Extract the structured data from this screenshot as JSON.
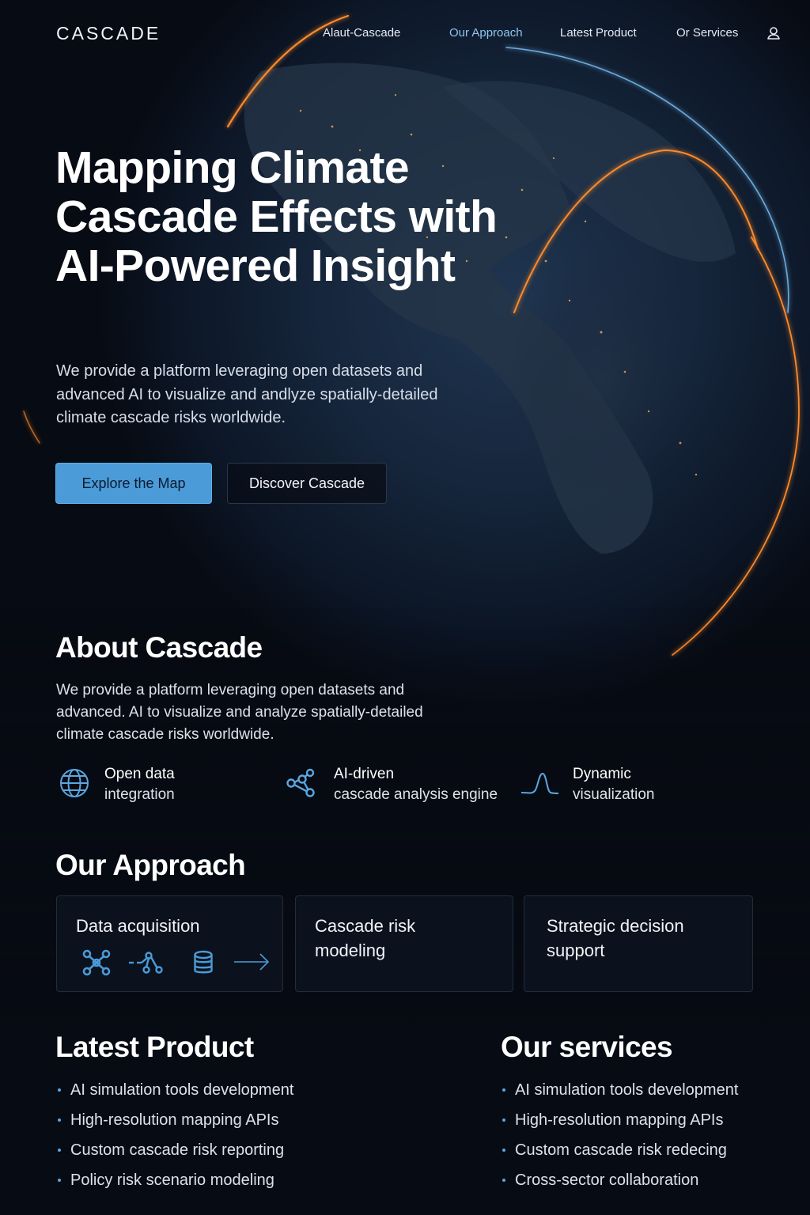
{
  "brand": {
    "logo": "CASCADE"
  },
  "nav": {
    "items": [
      {
        "label": "Alaut-Cascade",
        "active": false
      },
      {
        "label": "Our Approach",
        "active": true
      },
      {
        "label": "Latest Product",
        "active": false
      },
      {
        "label": "Or Services",
        "active": false
      }
    ],
    "account_icon": "user-icon"
  },
  "hero": {
    "title": "Mapping Climate Cascade Effects with AI-Powered Insight",
    "subtitle": "We provide a platform leveraging open datasets and advanced AI to visualize and andlyze spatially-detailed climate cascade risks worldwide.",
    "primary_button": "Explore the Map",
    "secondary_button": "Discover Cascade"
  },
  "about": {
    "heading": "About Cascade",
    "text": "We provide a platform leveraging open datasets and advanced. AI to visualize and analyze spatially-detailed climate cascade risks worldwide.",
    "features": [
      {
        "icon": "globe-icon",
        "line1": "Open data",
        "line2": "integration"
      },
      {
        "icon": "network-nodes-icon",
        "line1": "AI-driven",
        "line2": "cascade analysis engine"
      },
      {
        "icon": "wave-chart-icon",
        "line1": "Dynamic",
        "line2": "visualization"
      }
    ]
  },
  "approach": {
    "heading": "Our Approach",
    "cards": [
      {
        "title": "Data acquisition",
        "icons": [
          "molecule-icon",
          "node-link-icon",
          "database-icon",
          "arrow-right-icon"
        ]
      },
      {
        "title": "Cascade risk modeling"
      },
      {
        "title": "Strategic decision support"
      }
    ]
  },
  "latest_product": {
    "heading": "Latest Product",
    "items": [
      "AI simulation tools development",
      "High-resolution mapping APIs",
      "Custom cascade risk reporting",
      "Policy risk scenario modeling"
    ]
  },
  "services": {
    "heading": "Our services",
    "items": [
      "AI simulation tools development",
      "High-resolution mapping APIs",
      "Custom cascade risk redecing",
      "Cross-sector collaboration"
    ]
  },
  "colors": {
    "background": "#070b13",
    "accent": "#4a9bd8",
    "arc_orange": "#ff8a2a",
    "arc_blue": "#6fc3ff"
  }
}
